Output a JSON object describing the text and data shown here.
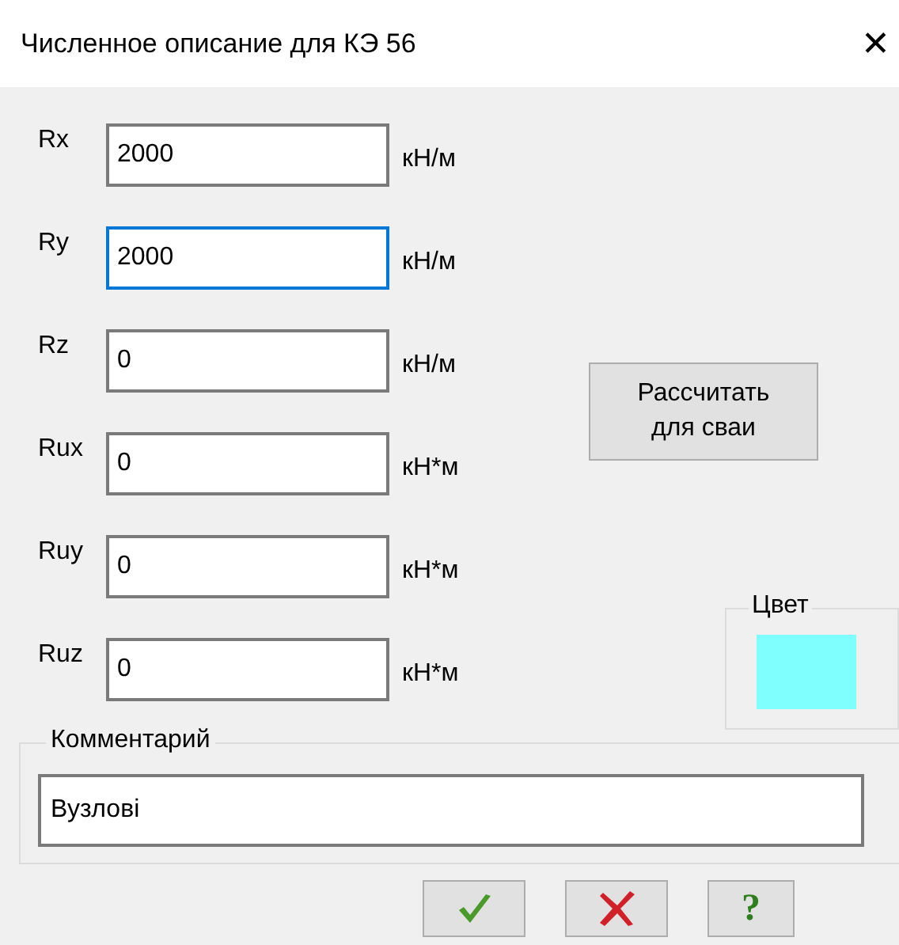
{
  "window": {
    "title": "Численное описание для КЭ 56",
    "close": "✕"
  },
  "fields": [
    {
      "label": "Rx",
      "value": "2000",
      "unit": "кН/м",
      "focused": false
    },
    {
      "label": "Ry",
      "value": "2000",
      "unit": "кН/м",
      "focused": true
    },
    {
      "label": "Rz",
      "value": "0",
      "unit": "кН/м",
      "focused": false
    },
    {
      "label": "Rux",
      "value": "0",
      "unit": "кН*м",
      "focused": false
    },
    {
      "label": "Ruy",
      "value": "0",
      "unit": "кН*м",
      "focused": false
    },
    {
      "label": "Ruz",
      "value": "0",
      "unit": "кН*м",
      "focused": false
    }
  ],
  "calc_button": {
    "line_1": "Рассчитать",
    "line_2": "для сваи"
  },
  "color_group": {
    "title": "Цвет",
    "color": "#80ffff"
  },
  "comment": {
    "title": "Комментарий",
    "value": "Вузлові"
  },
  "buttons": [
    {
      "kind": "ok"
    },
    {
      "kind": "cancel"
    },
    {
      "kind": "help",
      "glyph": "?"
    }
  ]
}
